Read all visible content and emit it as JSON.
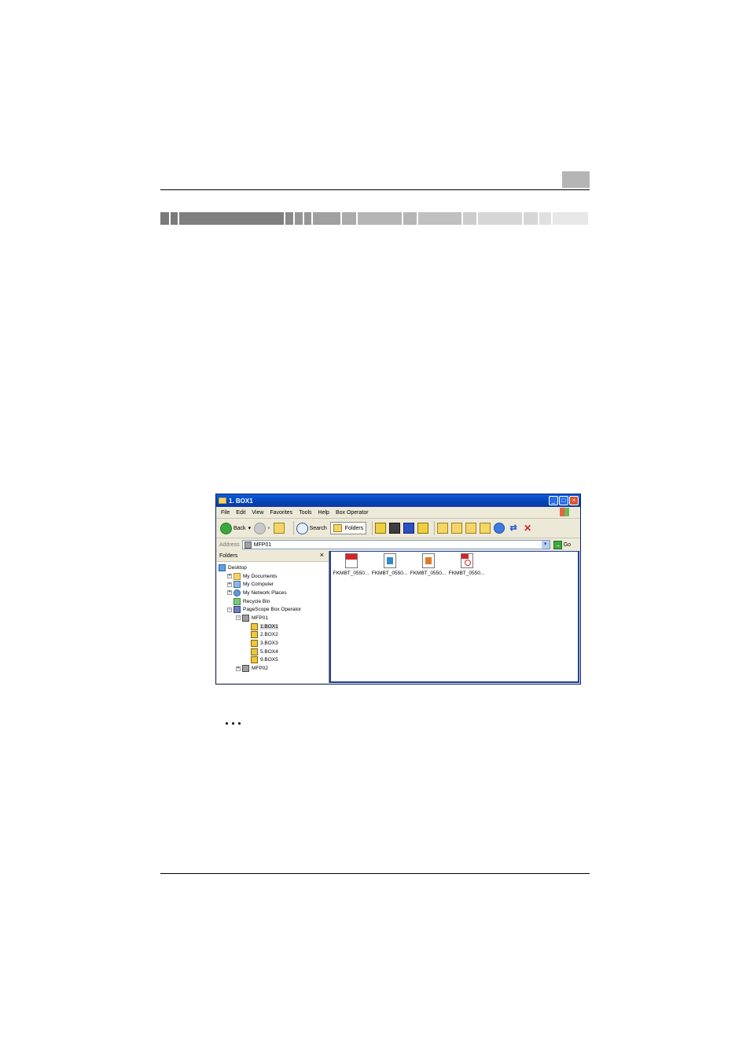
{
  "page": {
    "title_bar_colors": [
      "#7a7a7a",
      "#7f7f7f",
      "#8a8a8a",
      "#959595",
      "#a0a0a0",
      "#aaaaaa",
      "#b5b5b5",
      "#c0c0c0",
      "#cccccc",
      "#d6d6d6",
      "#e0e0e0",
      "#e8e8e8"
    ]
  },
  "window": {
    "title": "1. BOX1",
    "menu": [
      "File",
      "Edit",
      "View",
      "Favorites",
      "Tools",
      "Help",
      "Box Operator"
    ],
    "toolbar": {
      "back": "Back",
      "search": "Search",
      "folders": "Folders"
    },
    "address": {
      "label": "Address",
      "value": "MFP01",
      "go": "Go"
    },
    "folder_pane": {
      "title": "Folders",
      "close": "×",
      "tree": [
        {
          "label": "Desktop",
          "indent": 0,
          "toggle": "",
          "icon": "desktop-icon"
        },
        {
          "label": "My Documents",
          "indent": 1,
          "toggle": "+",
          "icon": "my-documents-icon"
        },
        {
          "label": "My Computer",
          "indent": 1,
          "toggle": "+",
          "icon": "my-computer-icon"
        },
        {
          "label": "My Network Places",
          "indent": 1,
          "toggle": "+",
          "icon": "network-places-icon"
        },
        {
          "label": "Recycle Bin",
          "indent": 1,
          "toggle": "",
          "icon": "recycle-bin-icon"
        },
        {
          "label": "PageScope Box Operator",
          "indent": 1,
          "toggle": "−",
          "icon": "pagescope-icon"
        },
        {
          "label": "MFP01",
          "indent": 2,
          "toggle": "−",
          "icon": "mfp-icon"
        },
        {
          "label": "1.BOX1",
          "indent": 3,
          "toggle": "",
          "icon": "box-icon",
          "selected": true
        },
        {
          "label": "2.BOX2",
          "indent": 3,
          "toggle": "",
          "icon": "box-icon"
        },
        {
          "label": "3.BOX3",
          "indent": 3,
          "toggle": "",
          "icon": "box-icon"
        },
        {
          "label": "5.BOX4",
          "indent": 3,
          "toggle": "",
          "icon": "box-icon"
        },
        {
          "label": "9.BOX5",
          "indent": 3,
          "toggle": "",
          "icon": "box-icon"
        },
        {
          "label": "MFP02",
          "indent": 2,
          "toggle": "+",
          "icon": "mfp-icon"
        }
      ]
    },
    "files": [
      {
        "name": "FKMBT_0550...",
        "icon": "compact-pdf-file-icon"
      },
      {
        "name": "FKMBT_0550...",
        "icon": "image-file-icon"
      },
      {
        "name": "FKMBT_0550...",
        "icon": "image-file-icon"
      },
      {
        "name": "FKMBT_0550...",
        "icon": "pdf-file-icon"
      }
    ]
  }
}
